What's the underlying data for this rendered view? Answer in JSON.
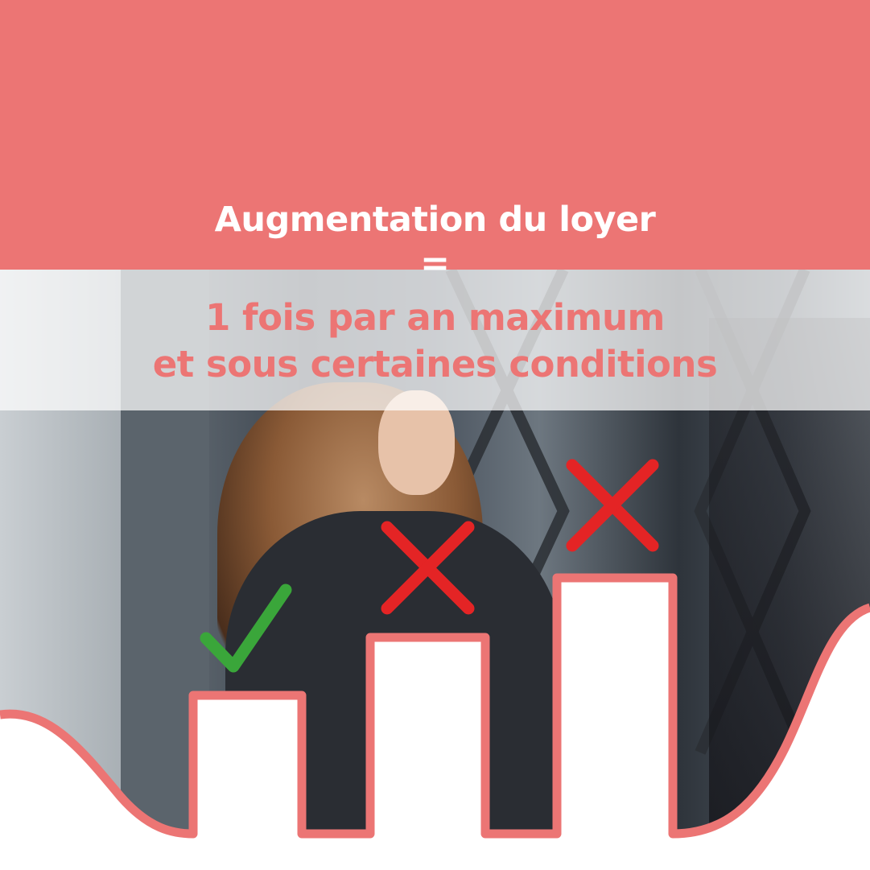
{
  "header": {
    "title": "Augmentation du loyer",
    "separator": "=",
    "subtitle_line1": "1 fois par an maximum",
    "subtitle_line2": "et sous certaines conditions"
  },
  "colors": {
    "accent": "#ec7574",
    "check": "#3aa63a",
    "cross": "#e42425",
    "white": "#ffffff"
  },
  "steps": [
    {
      "level": 1,
      "status": "allowed",
      "icon": "check-icon"
    },
    {
      "level": 2,
      "status": "not-allowed",
      "icon": "cross-icon"
    },
    {
      "level": 3,
      "status": "not-allowed",
      "icon": "cross-icon"
    }
  ]
}
